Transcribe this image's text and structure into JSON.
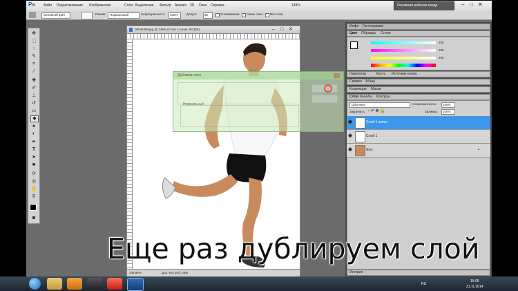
{
  "menubar": {
    "app_icon": "Ps",
    "items": [
      "Файл",
      "Редактирование",
      "Изображение",
      "Слои",
      "Выделение",
      "Фильтр",
      "Анализ",
      "3D",
      "Окно",
      "Справка"
    ],
    "zoom": "149%",
    "workspace_button": "Основная рабочая среда"
  },
  "options": {
    "preset": "Основной цвет",
    "mode_label": "Режим:",
    "mode_value": "Нормальный",
    "opacity_label": "Непрозрачность:",
    "opacity_value": "100%",
    "tolerance_label": "Допуск:",
    "tolerance_value": "32",
    "antialias_label": "Сглаживание",
    "contiguous_label": "Смеж. пикс.",
    "all_layers_label": "Все слои"
  },
  "document": {
    "title": "00045458.jpg @ 149% (Слой 1 копия, RGB/8)",
    "zoom": "148,96%",
    "status": "Док: 454,3K/1,04M"
  },
  "dialog": {
    "title": "Дубликат слоя",
    "mode_text": "Нормальный"
  },
  "panels": {
    "top_tabs": [
      "Цвет",
      "Образцы",
      "Стили"
    ],
    "top_tabs_alt": [
      "Инфо",
      "Гистограмма"
    ],
    "color_values": {
      "r": "255",
      "g": "255",
      "b": "255"
    },
    "nav_tabs": [
      "Навигатор",
      "Кисть",
      "Источник клона"
    ],
    "adjust_tabs": [
      "Символ",
      "Абзац"
    ],
    "correction_tabs": [
      "Коррекция",
      "Маски"
    ],
    "layers_tabs": [
      "Слои",
      "Каналы",
      "Контуры"
    ],
    "blend_mode": "Обычные",
    "opacity_label": "Непрозрачность:",
    "opacity_value": "100%",
    "lock_label": "Закрепить:",
    "fill_label": "Заливка:",
    "fill_value": "100%",
    "layers": [
      {
        "name": "Слой 1 копия",
        "selected": true
      },
      {
        "name": "Слой 1",
        "selected": false
      },
      {
        "name": "Фон",
        "selected": false
      }
    ],
    "history_tab": "История"
  },
  "taskbar": {
    "lang": "RU",
    "time": "15:05",
    "date": "21.11.2014"
  },
  "subtitle": "Еще раз дублируем слой"
}
